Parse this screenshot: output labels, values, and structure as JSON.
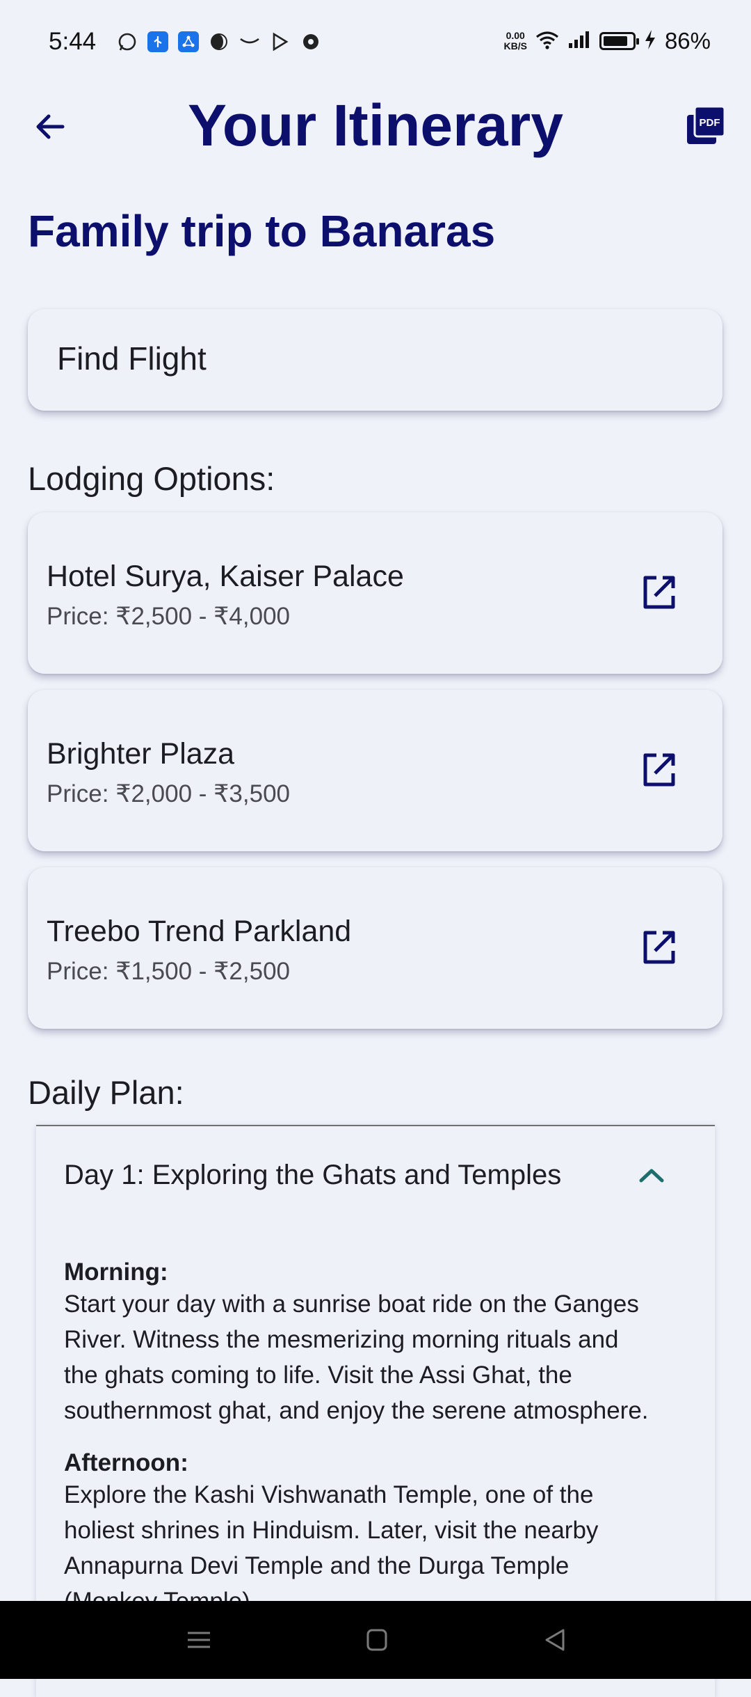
{
  "status": {
    "time": "5:44",
    "left_icons": [
      "whatsapp-icon",
      "usb-icon",
      "share-icon",
      "half-moon-icon",
      "amazon-icon",
      "play-icon",
      "ball-icon"
    ],
    "netspeed_value": "0.00",
    "netspeed_unit": "KB/S",
    "battery_pct": "86%",
    "battery_level": 0.86
  },
  "header": {
    "title": "Your Itinerary",
    "pdf_label": "PDF"
  },
  "trip": {
    "title": "Family trip to Banaras"
  },
  "flight": {
    "label": "Find Flight"
  },
  "lodging": {
    "heading": "Lodging Options:",
    "items": [
      {
        "name": "Hotel Surya, Kaiser Palace",
        "price": "Price: ₹2,500 - ₹4,000"
      },
      {
        "name": "Brighter Plaza",
        "price": "Price: ₹2,000 - ₹3,500"
      },
      {
        "name": "Treebo Trend Parkland",
        "price": "Price: ₹1,500 - ₹2,500"
      }
    ]
  },
  "daily": {
    "heading": "Daily Plan:",
    "day1": {
      "title": "Day 1: Exploring the Ghats and Temples",
      "morning_label": "Morning:",
      "morning_text": "Start your day with a sunrise boat ride on the Ganges\nRiver. Witness the mesmerizing morning rituals and\nthe ghats coming to life. Visit the Assi Ghat, the\nsouthernmost ghat, and enjoy the serene atmosphere.",
      "afternoon_label": "Afternoon:",
      "afternoon_text": "Explore the Kashi Vishwanath Temple, one of the\nholiest shrines in Hinduism.  Later, visit the nearby\nAnnapurna Devi Temple and the Durga Temple\n(Monkey Temple)."
    }
  },
  "colors": {
    "accent": "#0c0f6b",
    "background": "#eff2f8",
    "chevron": "#1f6e6e"
  }
}
